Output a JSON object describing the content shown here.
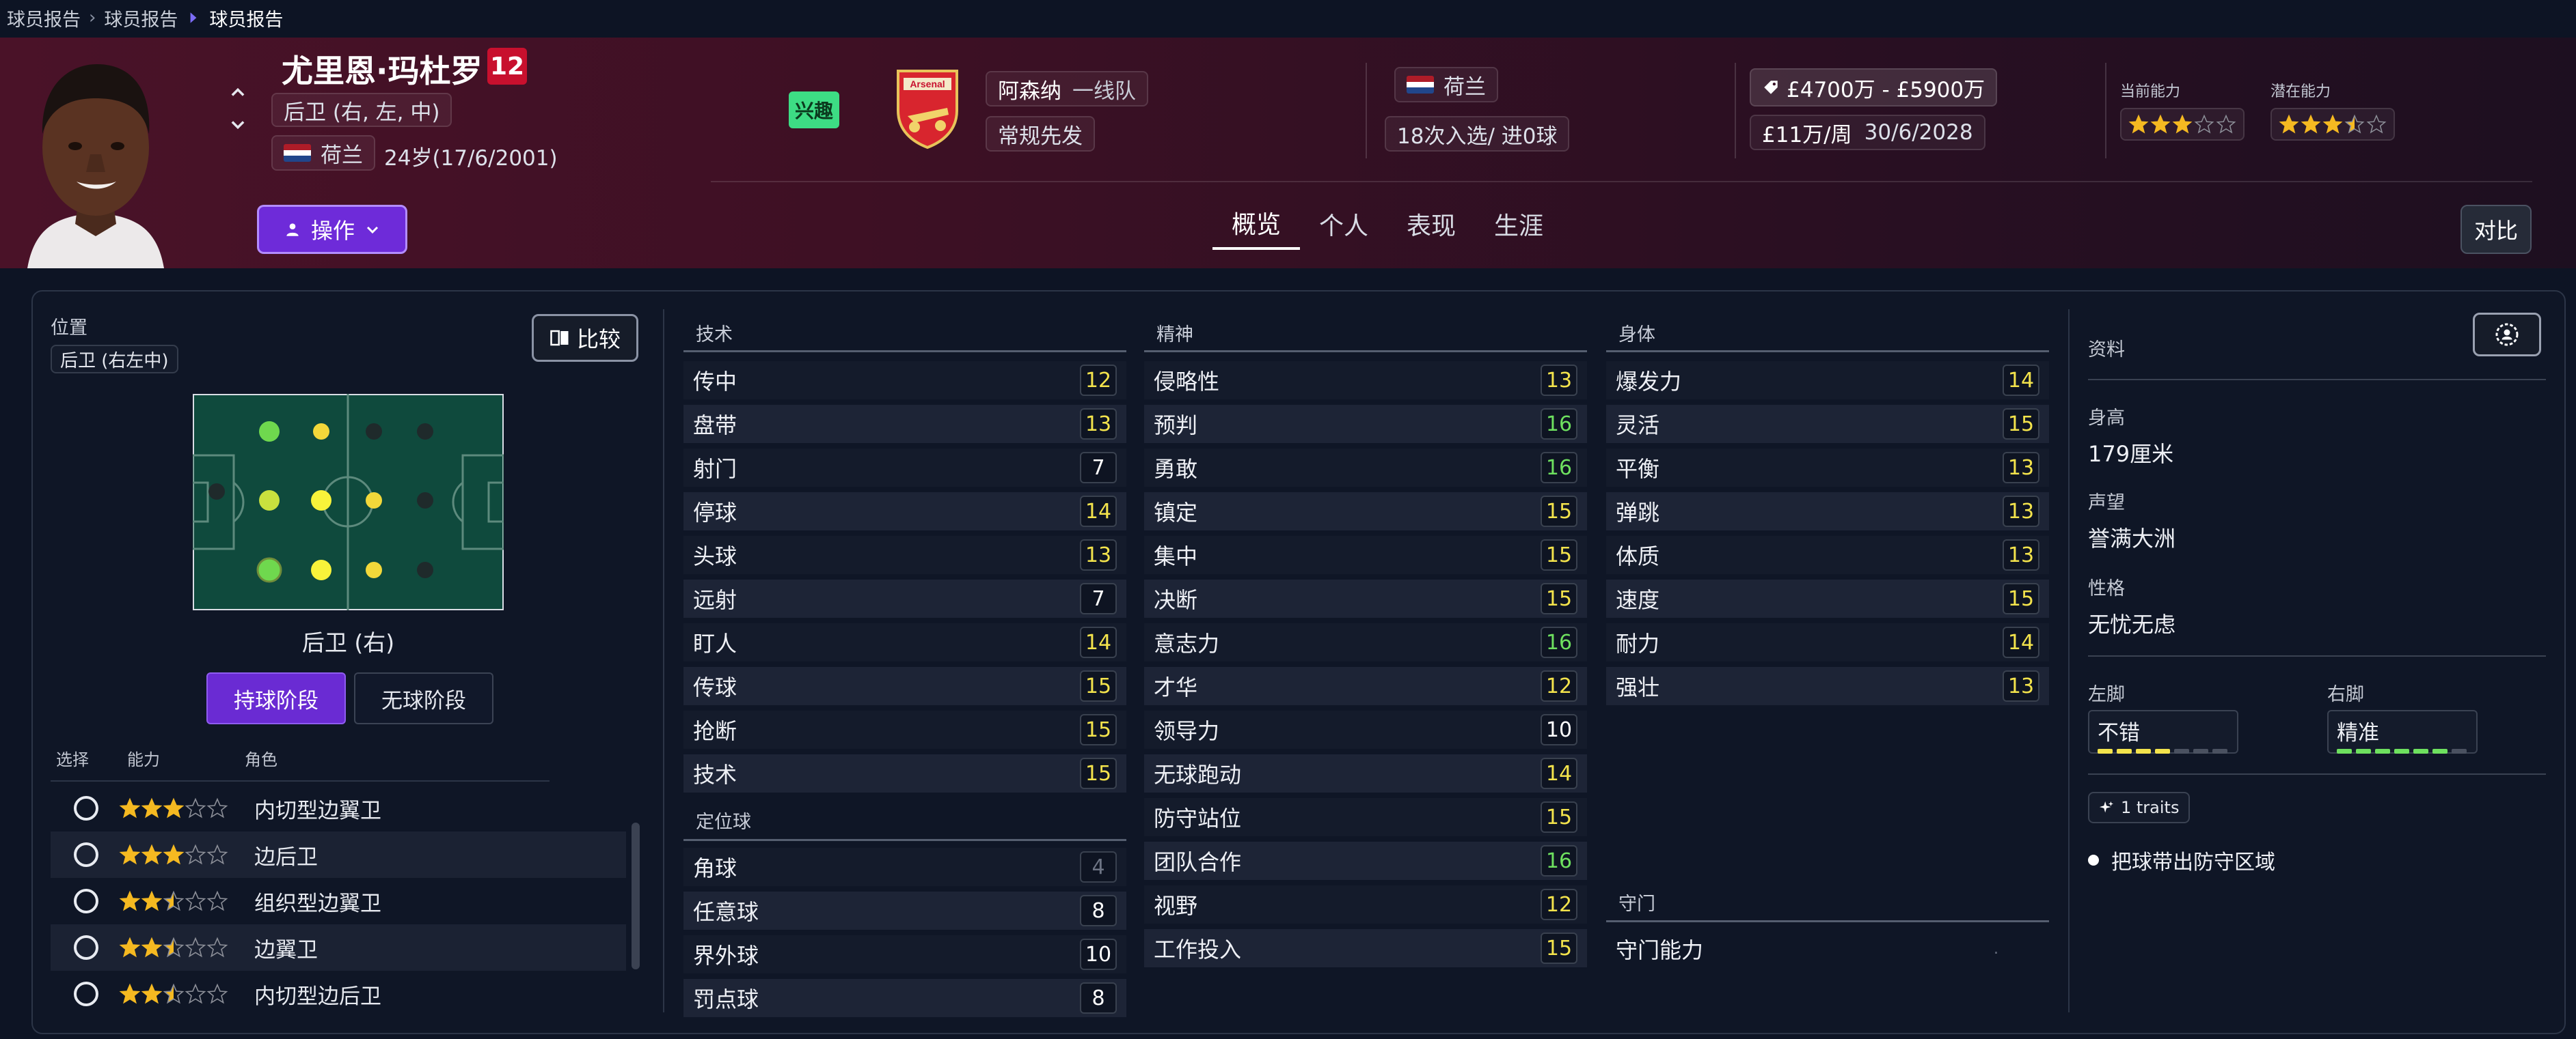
{
  "breadcrumb": [
    "球员报告",
    "球员报告",
    "球员报告"
  ],
  "player": {
    "name": "尤里恩·玛杜罗",
    "number": "12",
    "position": "后卫 (右, 左, 中)",
    "nation": "荷兰",
    "age": "24岁(17/6/2001)",
    "interest_badge": "兴趣"
  },
  "club": {
    "name": "阿森纳",
    "squad": "一线队",
    "role": "常规先发",
    "crest_text": "Arsenal"
  },
  "international": {
    "nation": "荷兰",
    "caps": "18次入选/ 进0球"
  },
  "contract": {
    "value": "£4700万 - £5900万",
    "wage": "£11万/周",
    "expiry": "30/6/2028"
  },
  "ability": {
    "current_label": "当前能力",
    "potential_label": "潜在能力",
    "current_stars": 3,
    "potential_stars": 3.5
  },
  "action_button": "操作",
  "tabs": [
    "概览",
    "个人",
    "表现",
    "生涯"
  ],
  "compare_top": "对比",
  "position_panel": {
    "title": "位置",
    "chip": "后卫 (右左中)",
    "compare_btn": "比较",
    "selected_position": "后卫 (右)",
    "phase_on": "持球阶段",
    "phase_off": "无球阶段",
    "role_headers": {
      "select": "选择",
      "ability": "能力",
      "role": "角色"
    },
    "roles": [
      {
        "name": "内切型边翼卫",
        "stars": 3
      },
      {
        "name": "边后卫",
        "stars": 3
      },
      {
        "name": "组织型边翼卫",
        "stars": 2.5
      },
      {
        "name": "边翼卫",
        "stars": 2.5
      },
      {
        "name": "内切型边后卫",
        "stars": 2.5
      }
    ]
  },
  "technical": {
    "title": "技术",
    "attrs": [
      {
        "name": "传中",
        "value": "12",
        "tier": "yellow"
      },
      {
        "name": "盘带",
        "value": "13",
        "tier": "yellow"
      },
      {
        "name": "射门",
        "value": "7",
        "tier": "white"
      },
      {
        "name": "停球",
        "value": "14",
        "tier": "yellow"
      },
      {
        "name": "头球",
        "value": "13",
        "tier": "yellow"
      },
      {
        "name": "远射",
        "value": "7",
        "tier": "white"
      },
      {
        "name": "盯人",
        "value": "14",
        "tier": "yellow"
      },
      {
        "name": "传球",
        "value": "15",
        "tier": "yellow"
      },
      {
        "name": "抢断",
        "value": "15",
        "tier": "yellow"
      },
      {
        "name": "技术",
        "value": "15",
        "tier": "yellow"
      }
    ]
  },
  "set_pieces": {
    "title": "定位球",
    "attrs": [
      {
        "name": "角球",
        "value": "4",
        "tier": "grey"
      },
      {
        "name": "任意球",
        "value": "8",
        "tier": "white"
      },
      {
        "name": "界外球",
        "value": "10",
        "tier": "white"
      },
      {
        "name": "罚点球",
        "value": "8",
        "tier": "white"
      }
    ]
  },
  "mental": {
    "title": "精神",
    "attrs": [
      {
        "name": "侵略性",
        "value": "13",
        "tier": "yellow"
      },
      {
        "name": "预判",
        "value": "16",
        "tier": "green"
      },
      {
        "name": "勇敢",
        "value": "16",
        "tier": "green"
      },
      {
        "name": "镇定",
        "value": "15",
        "tier": "yellow"
      },
      {
        "name": "集中",
        "value": "15",
        "tier": "yellow"
      },
      {
        "name": "决断",
        "value": "15",
        "tier": "yellow"
      },
      {
        "name": "意志力",
        "value": "16",
        "tier": "green"
      },
      {
        "name": "才华",
        "value": "12",
        "tier": "yellow"
      },
      {
        "name": "领导力",
        "value": "10",
        "tier": "white"
      },
      {
        "name": "无球跑动",
        "value": "14",
        "tier": "yellow"
      },
      {
        "name": "防守站位",
        "value": "15",
        "tier": "yellow"
      },
      {
        "name": "团队合作",
        "value": "16",
        "tier": "green"
      },
      {
        "name": "视野",
        "value": "12",
        "tier": "yellow"
      },
      {
        "name": "工作投入",
        "value": "15",
        "tier": "yellow"
      }
    ]
  },
  "physical": {
    "title": "身体",
    "attrs": [
      {
        "name": "爆发力",
        "value": "14",
        "tier": "yellow"
      },
      {
        "name": "灵活",
        "value": "15",
        "tier": "yellow"
      },
      {
        "name": "平衡",
        "value": "13",
        "tier": "yellow"
      },
      {
        "name": "弹跳",
        "value": "13",
        "tier": "yellow"
      },
      {
        "name": "体质",
        "value": "13",
        "tier": "yellow"
      },
      {
        "name": "速度",
        "value": "15",
        "tier": "yellow"
      },
      {
        "name": "耐力",
        "value": "14",
        "tier": "yellow"
      },
      {
        "name": "强壮",
        "value": "13",
        "tier": "yellow"
      }
    ]
  },
  "goalkeeping": {
    "title": "守门",
    "attr_name": "守门能力",
    "value": "."
  },
  "profile": {
    "title": "资料",
    "height_label": "身高",
    "height": "179厘米",
    "reputation_label": "声望",
    "reputation": "誉满大洲",
    "personality_label": "性格",
    "personality": "无忧无虑",
    "left_foot_label": "左脚",
    "left_foot": "不错",
    "left_foot_level": 4,
    "right_foot_label": "右脚",
    "right_foot": "精准",
    "right_foot_level": 6,
    "traits_chip": "1 traits",
    "trait": "把球带出防守区域"
  },
  "colors": {
    "accent": "#6e2bd9",
    "yellow": "#f3e34c",
    "green": "#6ee05f",
    "star": "#f5b921"
  }
}
